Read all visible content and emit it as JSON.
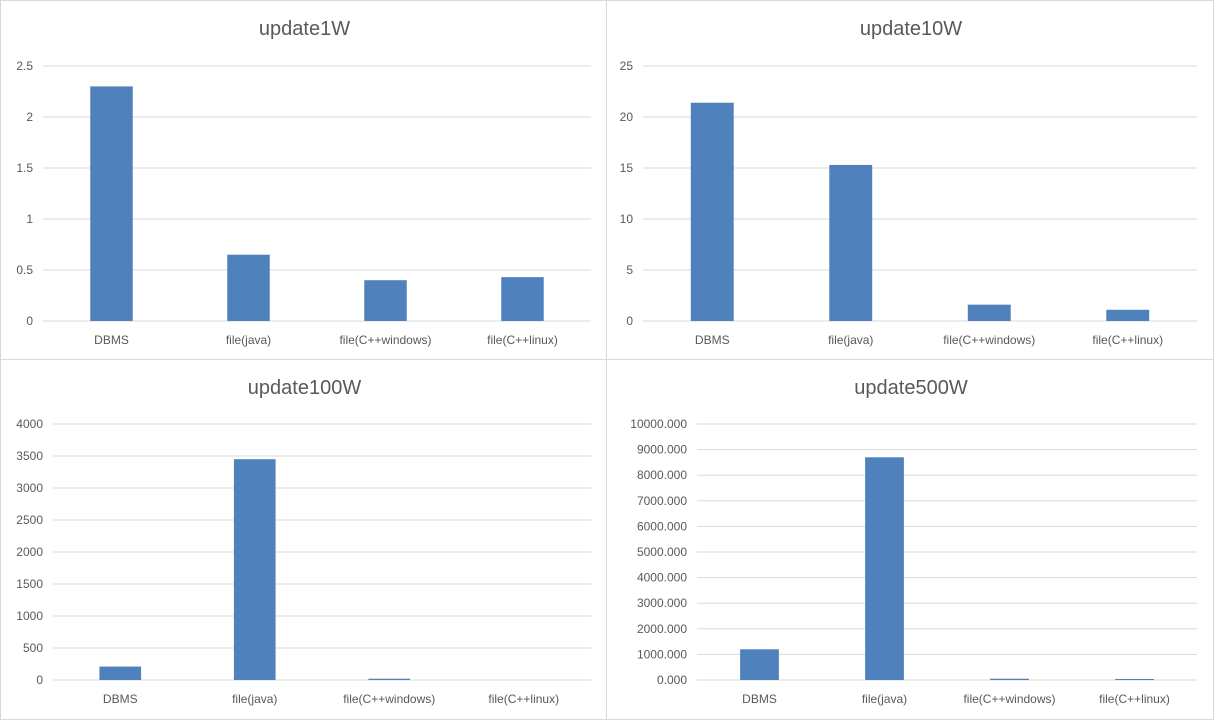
{
  "chart_data": [
    {
      "type": "bar",
      "title": "update1W",
      "categories": [
        "DBMS",
        "file(java)",
        "file(C++windows)",
        "file(C++linux)"
      ],
      "values": [
        2.3,
        0.65,
        0.4,
        0.43
      ],
      "ylim": [
        0,
        2.5
      ],
      "yticks": [
        "0",
        "0.5",
        "1",
        "1.5",
        "2",
        "2.5"
      ],
      "grid": true,
      "bar_color": "#4f81bd"
    },
    {
      "type": "bar",
      "title": "update10W",
      "categories": [
        "DBMS",
        "file(java)",
        "file(C++windows)",
        "file(C++linux)"
      ],
      "values": [
        21.4,
        15.3,
        1.6,
        1.1
      ],
      "ylim": [
        0,
        25
      ],
      "yticks": [
        "0",
        "5",
        "10",
        "15",
        "20",
        "25"
      ],
      "grid": true,
      "bar_color": "#4f81bd"
    },
    {
      "type": "bar",
      "title": "update100W",
      "categories": [
        "DBMS",
        "file(java)",
        "file(C++windows)",
        "file(C++linux)"
      ],
      "values": [
        210,
        3450,
        20,
        0
      ],
      "ylim": [
        0,
        4000
      ],
      "yticks": [
        "0",
        "500",
        "1000",
        "1500",
        "2000",
        "2500",
        "3000",
        "3500",
        "4000"
      ],
      "grid": true,
      "bar_color": "#4f81bd"
    },
    {
      "type": "bar",
      "title": "update500W",
      "categories": [
        "DBMS",
        "file(java)",
        "file(C++windows)",
        "file(C++linux)"
      ],
      "values": [
        1200,
        8700,
        50,
        40
      ],
      "ylim": [
        0,
        10000
      ],
      "yticks": [
        "0.000",
        "1000.000",
        "2000.000",
        "3000.000",
        "4000.000",
        "5000.000",
        "6000.000",
        "7000.000",
        "8000.000",
        "9000.000",
        "10000.000"
      ],
      "grid": true,
      "bar_color": "#4f81bd"
    }
  ]
}
